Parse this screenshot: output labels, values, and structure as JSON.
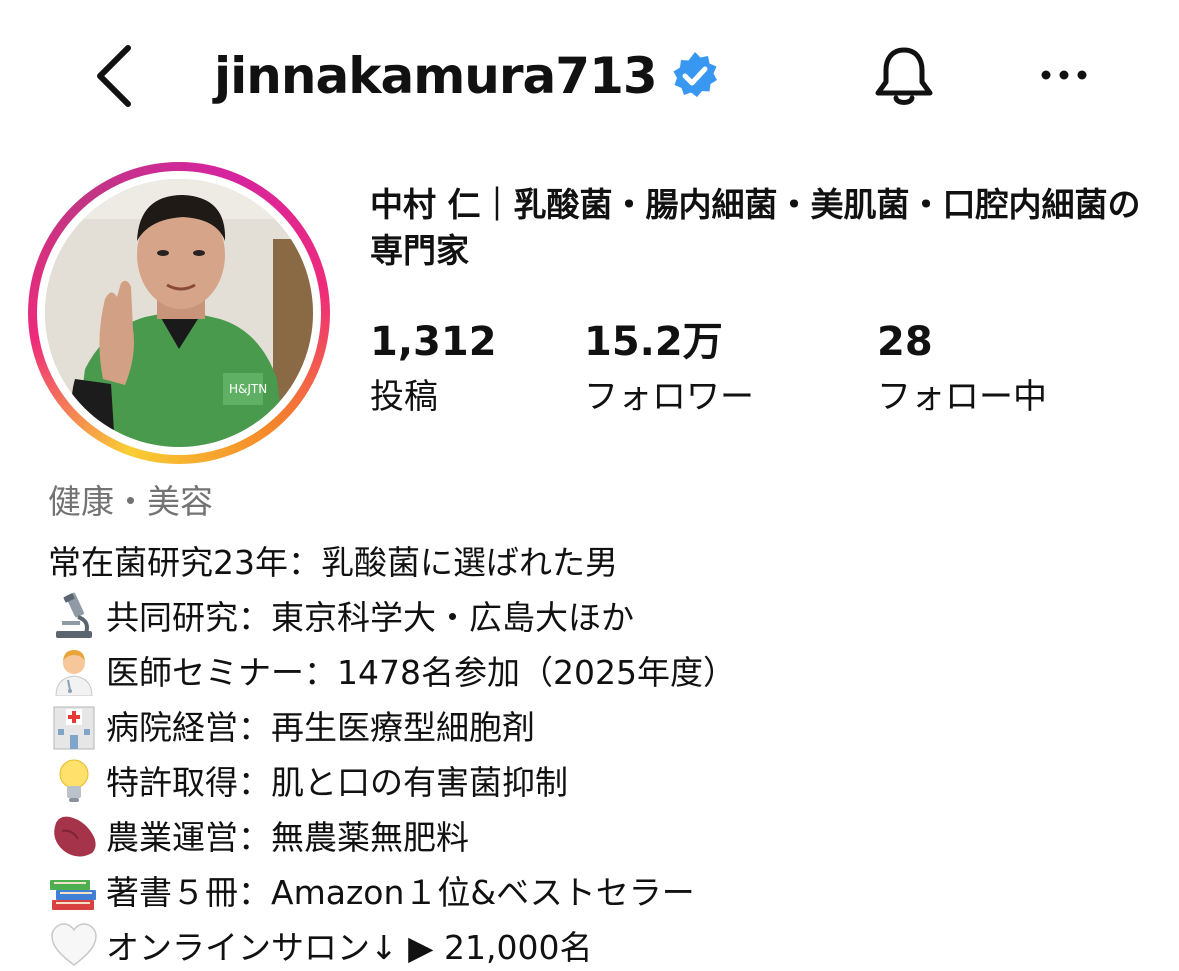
{
  "header": {
    "username": "jinnakamura713",
    "icons": {
      "back": "chevron-left-icon",
      "verified": "verified-badge-icon",
      "notifications": "bell-icon",
      "more": "more-horizontal-icon"
    }
  },
  "profile": {
    "display_name": "中村 仁｜乳酸菌・腸内細菌・美肌菌・口腔内細菌の専門家",
    "stats": [
      {
        "value": "1,312",
        "label": "投稿"
      },
      {
        "value": "15.2万",
        "label": "フォロワー"
      },
      {
        "value": "28",
        "label": "フォロー中"
      }
    ],
    "category": "健康・美容",
    "bio": [
      {
        "emoji": "",
        "text": "常在菌研究23年：乳酸菌に選ばれた男"
      },
      {
        "emoji": "microscope-icon",
        "text": "共同研究：東京科学大・広島大ほか"
      },
      {
        "emoji": "health-worker-icon",
        "text": "医師セミナー：1478名参加（2025年度）"
      },
      {
        "emoji": "hospital-icon",
        "text": "病院経営：再生医療型細胞剤"
      },
      {
        "emoji": "light-bulb-icon",
        "text": "特許取得：肌と口の有害菌抑制"
      },
      {
        "emoji": "sweet-potato-icon",
        "text": "農業運営：無農薬無肥料"
      },
      {
        "emoji": "books-icon",
        "text": "著書５冊：Amazon１位&ベストセラー"
      },
      {
        "emoji": "white-heart-icon",
        "text": "オンラインサロン↓ ▶ 21,000名"
      }
    ]
  },
  "colors": {
    "text": "#111111",
    "muted": "#737373",
    "verified": "#3897f0",
    "shirt": "#4a9a4e"
  }
}
